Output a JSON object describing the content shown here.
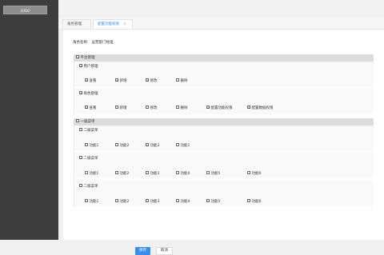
{
  "sidebar": {
    "logo": "LOGO"
  },
  "tabs": [
    {
      "label": "角色管理",
      "close": "×",
      "active": false
    },
    {
      "label": "配置功能权限",
      "close": "×",
      "active": true
    }
  ],
  "role": {
    "label": "角色名称:",
    "value": "运营部门经理"
  },
  "groups": [
    {
      "label": "平台管理",
      "checked": false,
      "subgroups": [
        {
          "label": "用户管理",
          "checked": true,
          "items": [
            {
              "label": "查看",
              "checked": true
            },
            {
              "label": "新增",
              "checked": true
            },
            {
              "label": "修改",
              "checked": true
            },
            {
              "label": "删除",
              "checked": false
            }
          ]
        },
        {
          "label": "角色管理",
          "checked": true,
          "items": [
            {
              "label": "查看",
              "checked": true
            },
            {
              "label": "新增",
              "checked": false
            },
            {
              "label": "修改",
              "checked": false
            },
            {
              "label": "删除",
              "checked": false
            },
            {
              "label": "配置功能权限",
              "checked": true
            },
            {
              "label": "配置数据权限",
              "checked": true
            }
          ]
        }
      ]
    },
    {
      "label": "一级菜单",
      "checked": false,
      "subgroups": [
        {
          "label": "二级菜单",
          "checked": false,
          "items": [
            {
              "label": "功能1",
              "checked": false
            },
            {
              "label": "功能2",
              "checked": false
            },
            {
              "label": "功能3",
              "checked": false
            },
            {
              "label": "功能1",
              "checked": false
            }
          ]
        },
        {
          "label": "二级菜单",
          "checked": false,
          "items": [
            {
              "label": "功能1",
              "checked": false
            },
            {
              "label": "功能2",
              "checked": false
            },
            {
              "label": "功能3",
              "checked": false
            },
            {
              "label": "功能4",
              "checked": false
            },
            {
              "label": "功能5",
              "checked": false
            },
            {
              "label": "功能6",
              "checked": false
            }
          ]
        },
        {
          "label": "二级菜单",
          "checked": false,
          "items": [
            {
              "label": "功能1",
              "checked": false
            },
            {
              "label": "功能2",
              "checked": false
            },
            {
              "label": "功能3",
              "checked": false
            },
            {
              "label": "功能4",
              "checked": false
            },
            {
              "label": "功能5",
              "checked": false
            },
            {
              "label": "功能6",
              "checked": false
            }
          ]
        }
      ]
    }
  ],
  "buttons": {
    "save": "保存",
    "cancel": "取消"
  }
}
